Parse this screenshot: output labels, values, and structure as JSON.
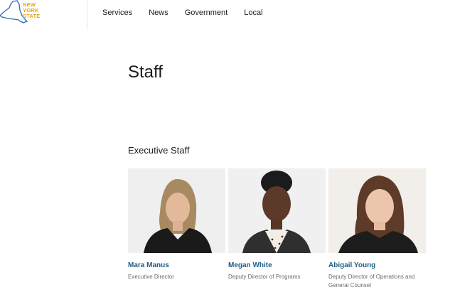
{
  "header": {
    "logo_lines": [
      "NEW",
      "YORK",
      "STATE"
    ],
    "nav": [
      "Services",
      "News",
      "Government",
      "Local"
    ]
  },
  "page_title": "Staff",
  "section_title": "Executive Staff",
  "staff": [
    {
      "name": "Mara Manus",
      "role": "Executive Director"
    },
    {
      "name": "Megan White",
      "role": "Deputy Director of Programs"
    },
    {
      "name": "Abigail Young",
      "role": "Deputy Director of Operations and General Counsel"
    }
  ],
  "colors": {
    "brand_blue": "#0d4f9c",
    "brand_gold": "#e8a317",
    "link": "#1f5e85"
  }
}
